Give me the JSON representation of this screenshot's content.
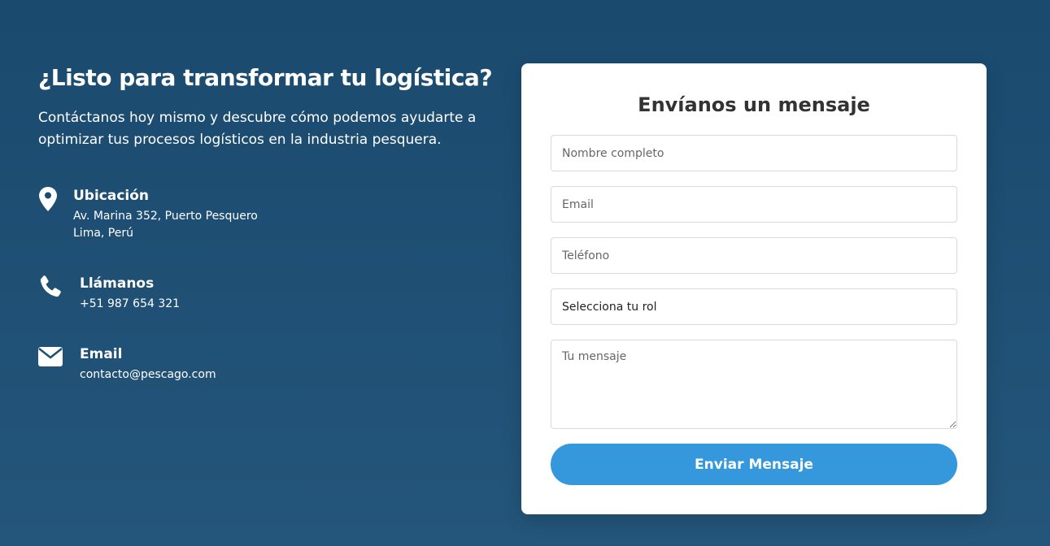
{
  "left": {
    "headline": "¿Listo para transformar tu logística?",
    "intro": "Contáctanos hoy mismo y descubre cómo podemos ayudarte a optimizar tus procesos logísticos en la industria pesquera.",
    "items": [
      {
        "icon": "location-pin-icon",
        "title": "Ubicación",
        "detail": "Av. Marina 352, Puerto Pesquero\nLima, Perú"
      },
      {
        "icon": "phone-icon",
        "title": "Llámanos",
        "detail": "+51 987 654 321"
      },
      {
        "icon": "envelope-icon",
        "title": "Email",
        "detail": "contacto@pescago.com"
      }
    ]
  },
  "form": {
    "title": "Envíanos un mensaje",
    "name_placeholder": "Nombre completo",
    "email_placeholder": "Email",
    "phone_placeholder": "Teléfono",
    "role_selected": "Selecciona tu rol",
    "message_placeholder": "Tu mensaje",
    "submit_label": "Enviar Mensaje"
  },
  "colors": {
    "background": "#1a4a6e",
    "accent": "#3598dc",
    "card": "#ffffff"
  }
}
